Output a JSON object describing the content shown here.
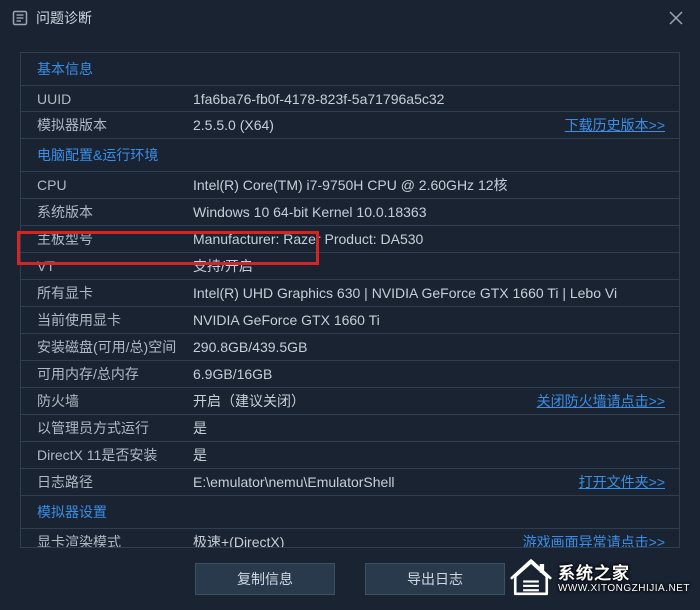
{
  "window": {
    "title": "问题诊断"
  },
  "sections": {
    "basic": {
      "header": "基本信息",
      "rows": [
        {
          "label": "UUID",
          "value": "1fa6ba76-fb0f-4178-823f-5a71796a5c32"
        },
        {
          "label": "模拟器版本",
          "value": "2.5.5.0 (X64)",
          "link": "下载历史版本>>"
        }
      ]
    },
    "env": {
      "header": "电脑配置&运行环境",
      "rows": [
        {
          "label": "CPU",
          "value": "Intel(R) Core(TM) i7-9750H CPU @ 2.60GHz 12核"
        },
        {
          "label": "系统版本",
          "value": "Windows 10 64-bit Kernel 10.0.18363"
        },
        {
          "label": "主板型号",
          "value": "Manufacturer: Razer  Product: DA530"
        },
        {
          "label": "VT",
          "value": "支持/开启"
        },
        {
          "label": "所有显卡",
          "value": "Intel(R) UHD Graphics 630 | NVIDIA GeForce GTX 1660 Ti | Lebo Vi"
        },
        {
          "label": "当前使用显卡",
          "value": "NVIDIA GeForce GTX 1660 Ti"
        },
        {
          "label": "安装磁盘(可用/总)空间",
          "value": "290.8GB/439.5GB"
        },
        {
          "label": "可用内存/总内存",
          "value": "6.9GB/16GB"
        },
        {
          "label": "防火墙",
          "value": "开启（建议关闭）",
          "link": "关闭防火墙请点击>>"
        },
        {
          "label": "以管理员方式运行",
          "value": "是"
        },
        {
          "label": "DirectX 11是否安装",
          "value": "是"
        },
        {
          "label": "日志路径",
          "value": "E:\\emulator\\nemu\\EmulatorShell",
          "link": "打开文件夹>>"
        }
      ]
    },
    "settings": {
      "header": "模拟器设置",
      "rows": [
        {
          "label": "显卡渲染模式",
          "value": "极速+(DirectX)",
          "link": "游戏画面异常请点击>>"
        }
      ]
    }
  },
  "footer": {
    "copy": "复制信息",
    "export": "导出日志"
  },
  "watermark": {
    "cn": "系统之家",
    "url": "WWW.XITONGZHIJIA.NET"
  }
}
